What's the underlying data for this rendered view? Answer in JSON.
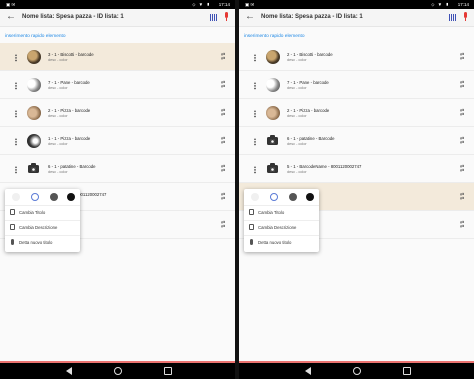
{
  "screens": [
    {
      "status": {
        "left_icons": "▣ ✉",
        "sys_icons": "⬦ ▼ ▮",
        "clock": "17:14"
      },
      "header": {
        "title": "Nome lista: Spesa pazza - ID lista: 1",
        "back_icon": "arrow-back-icon",
        "barcode_icon": "barcode-icon",
        "mic_icon": "mic-icon"
      },
      "section": {
        "label": "inserimento rapido elemento"
      },
      "items": [
        {
          "line1": "3 - 1 - Biscotti - barcode",
          "line2": "desc - color",
          "thumb": "bisc",
          "highlight": true
        },
        {
          "line1": "7 - 1 - Pane - barcode",
          "line2": "desc - color",
          "thumb": "pane",
          "highlight": false
        },
        {
          "line1": "2 - 1 - Pizza - barcode",
          "line2": "desc - color",
          "thumb": "pizza",
          "highlight": false
        },
        {
          "line1": "1 - 1 - Pizza - barcode",
          "line2": "desc - color",
          "thumb": "pizza1",
          "highlight": false
        },
        {
          "line1": "6 - 1 - patatine - Barcode",
          "line2": "desc - color",
          "thumb": "camera",
          "highlight": false
        },
        {
          "line1": "ke - barcode - 8001120002747",
          "line2": "",
          "thumb": "none",
          "highlight": false
        },
        {
          "line1": "ode",
          "line2": "",
          "thumb": "none",
          "highlight": false
        }
      ],
      "swap_icon": "swap-vert-icon",
      "popup": {
        "colors": [
          "#f0f0f0",
          "#ffffff",
          "#555555",
          "#111111"
        ],
        "menu": [
          {
            "label": "Cambia Titolo",
            "icon": "edit-icon"
          },
          {
            "label": "Cambia Descrizione",
            "icon": "edit-icon"
          },
          {
            "label": "Detta nuovo titolo",
            "icon": "mic-icon"
          }
        ]
      }
    },
    {
      "status": {
        "left_icons": "▣ ✉",
        "sys_icons": "⬦ ▼ ▮",
        "clock": "17:14"
      },
      "header": {
        "title": "Nome lista: Spesa pazza - ID lista: 1",
        "back_icon": "arrow-back-icon",
        "barcode_icon": "barcode-icon",
        "mic_icon": "mic-icon"
      },
      "section": {
        "label": "inserimento rapido elemento"
      },
      "items": [
        {
          "line1": "2 - 1 - Biscotti - barcode",
          "line2": "desc - color",
          "thumb": "bisc",
          "highlight": false
        },
        {
          "line1": "7 - 1 - Pane - barcode",
          "line2": "desc - color",
          "thumb": "pane",
          "highlight": false
        },
        {
          "line1": "2 - 1 - Pizza - barcode",
          "line2": "desc - color",
          "thumb": "pizza",
          "highlight": false
        },
        {
          "line1": "6 - 1 - patatine - Barcode",
          "line2": "desc - color",
          "thumb": "camera",
          "highlight": false
        },
        {
          "line1": "5 - 1 - BarcodeName - 8001120002747",
          "line2": "desc - color",
          "thumb": "camera",
          "highlight": false
        },
        {
          "line1": "rcode",
          "line2": "",
          "thumb": "none",
          "highlight": true
        },
        {
          "line1": "ode",
          "line2": "",
          "thumb": "none",
          "highlight": false
        }
      ],
      "swap_icon": "swap-vert-icon",
      "popup": {
        "colors": [
          "#f0f0f0",
          "#ffffff",
          "#555555",
          "#111111"
        ],
        "menu": [
          {
            "label": "Cambia Titolo",
            "icon": "edit-icon"
          },
          {
            "label": "Cambia Descrizione",
            "icon": "edit-icon"
          },
          {
            "label": "Detta nuovo titolo",
            "icon": "mic-icon"
          }
        ]
      }
    }
  ]
}
